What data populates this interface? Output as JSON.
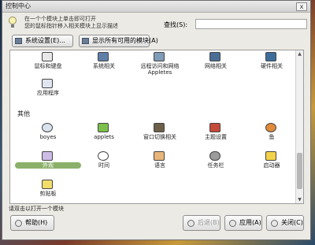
{
  "window": {
    "title": "控制中心",
    "close_label": "x"
  },
  "header": {
    "hint_line1": "在一个个模块上单击即可打开",
    "hint_line2": "您的鼠标指针移入相关模块上显示描述",
    "search_label": "查找(S):",
    "search_value": ""
  },
  "toolbar": {
    "btn1": "系统设置(E)...",
    "btn2": "显示所有可用的模块(A)"
  },
  "top_row": [
    {
      "label": "鼠标和键盘",
      "icon": "mouse-icon"
    },
    {
      "label": "系统相关",
      "icon": "monitor-icon"
    },
    {
      "label": "远程访问和网络\nAppletes",
      "icon": "network-icon"
    },
    {
      "label": "网络相关",
      "icon": "network-adapter-icon"
    },
    {
      "label": "硬件相关",
      "icon": "hardware-icon"
    }
  ],
  "second_row": [
    {
      "label": "应用程序",
      "icon": "app-icon"
    }
  ],
  "section_title": "其他",
  "other_row1": [
    {
      "label": "boyes",
      "icon": "eye-icon"
    },
    {
      "label": "applets",
      "icon": "green-package-icon"
    },
    {
      "label": "窗口切换相关",
      "icon": "window-icon"
    },
    {
      "label": "主题设置",
      "icon": "theme-icon"
    },
    {
      "label": "鱼",
      "icon": "fish-icon"
    }
  ],
  "other_row2": [
    {
      "label": "外观",
      "icon": "appearance-icon",
      "selected": true
    },
    {
      "label": "时间",
      "icon": "clock-icon"
    },
    {
      "label": "语言",
      "icon": "language-icon"
    },
    {
      "label": "任务栏",
      "icon": "taskbar-icon"
    },
    {
      "label": "启动器",
      "icon": "folder-icon"
    }
  ],
  "other_row3": [
    {
      "label": "剪贴板",
      "icon": "clipboard-icon"
    }
  ],
  "status_text": "请双击以打开一个模块",
  "bottom": {
    "help": "帮助(H)",
    "prev": "后退(B)",
    "apply": "应用(A)",
    "close": "关闭(C)"
  },
  "colors": {
    "selected": "#8bb06a"
  }
}
